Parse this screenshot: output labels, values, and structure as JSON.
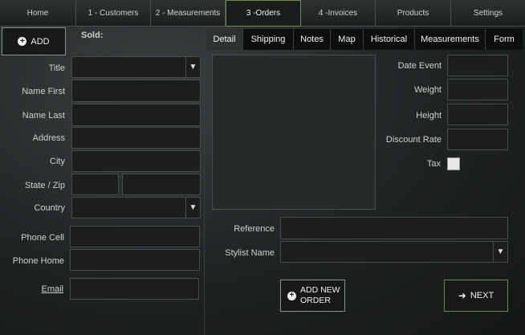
{
  "nav": {
    "tabs": [
      {
        "label": "Home"
      },
      {
        "label": "1 - Customers"
      },
      {
        "label": "2 - Measurements"
      },
      {
        "label": "3 -Orders"
      },
      {
        "label": "4 -Invoices"
      },
      {
        "label": "Products"
      },
      {
        "label": "Settings"
      }
    ],
    "active_index": 3
  },
  "left": {
    "add_label": "ADD",
    "sold_label": "Sold:",
    "fields": {
      "title": "Title",
      "name_first": "Name First",
      "name_last": "Name Last",
      "address": "Address",
      "city": "City",
      "state_zip": "State / Zip",
      "country": "Country",
      "phone_cell": "Phone Cell",
      "phone_home": "Phone Home",
      "email": "Email"
    }
  },
  "right": {
    "tabs": [
      {
        "label": "Detail"
      },
      {
        "label": "Shipping"
      },
      {
        "label": "Notes"
      },
      {
        "label": "Map"
      },
      {
        "label": "Historical"
      },
      {
        "label": "Measurements"
      },
      {
        "label": "Form"
      }
    ],
    "active_index": 0,
    "fields": {
      "date_event": "Date Event",
      "weight": "Weight",
      "height": "Height",
      "discount_rate": "Discount Rate",
      "tax": "Tax",
      "reference": "Reference",
      "stylist_name": "Stylist Name"
    },
    "add_new_order_line1": "ADD NEW",
    "add_new_order_line2": "ORDER",
    "next_label": "NEXT"
  },
  "colors": {
    "accent_border": "#6a8a4a",
    "background": "#1f2223"
  },
  "icons": {
    "add": "plus-circle-icon",
    "next": "arrow-right-icon",
    "dropdown": "triangle-down-icon"
  }
}
